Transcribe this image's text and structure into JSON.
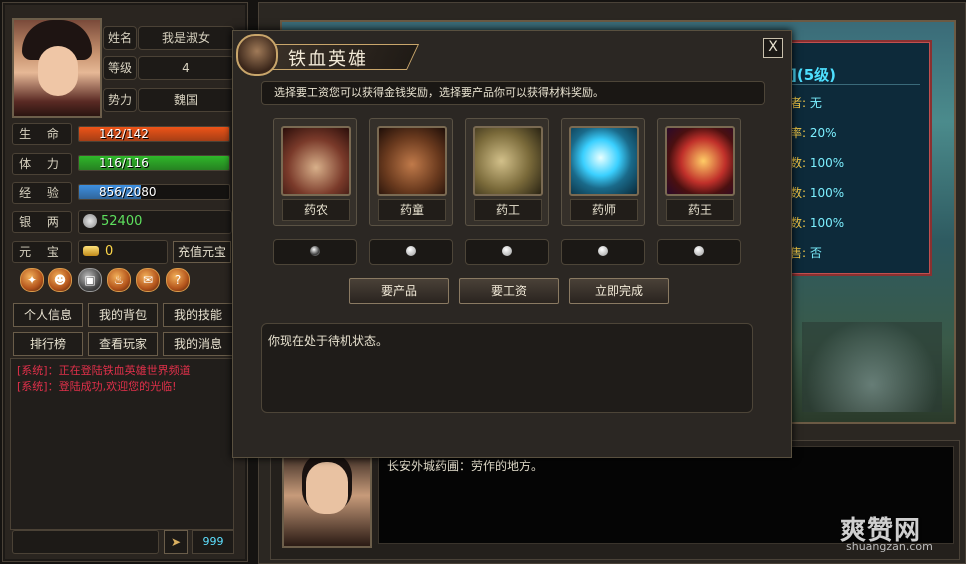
{
  "player": {
    "name_label": "姓名",
    "name": "我是淑女",
    "level_label": "等级",
    "level": "4",
    "faction_label": "势力",
    "faction": "魏国"
  },
  "stats": [
    {
      "label": "生 命",
      "text": "142/142",
      "fraction": 1.0,
      "color": "#ee5418"
    },
    {
      "label": "体 力",
      "text": "116/116",
      "fraction": 1.0,
      "color": "#2fb82a"
    },
    {
      "label": "经 验",
      "text": "856/2080",
      "fraction": 0.41,
      "color": "#3e8fe0"
    }
  ],
  "money": {
    "silver_label": "银 两",
    "silver": "52400",
    "gold_label": "元 宝",
    "gold": "0",
    "recharge": "充值元宝"
  },
  "menu": {
    "row1": [
      "个人信息",
      "我的背包",
      "我的技能"
    ],
    "row2": [
      "排行榜",
      "查看玩家",
      "我的消息"
    ]
  },
  "chat": [
    "[系统]：正在登陆铁血英雄世界频道",
    "[系统]：登陆成功,欢迎您的光临!"
  ],
  "chat_bottom": {
    "count": "999"
  },
  "info": {
    "title": "](5级)",
    "rows": [
      {
        "k": "者:",
        "v": "无"
      },
      {
        "k": "率:",
        "v": "20%"
      },
      {
        "k": "数:",
        "v": "100%"
      },
      {
        "k": "数:",
        "v": "100%"
      },
      {
        "k": "数:",
        "v": "100%"
      },
      {
        "k": "售:",
        "v": "否"
      }
    ]
  },
  "npc": {
    "text": "长安外城药圃：劳作的地方。"
  },
  "watermark": {
    "main": "爽赞网",
    "sub": "shuangzan.com"
  },
  "dialog": {
    "title": "铁血英雄",
    "close": "X",
    "hint": "选择要工资您可以获得金钱奖励，选择要产品你可以获得材料奖励。",
    "options": [
      {
        "name": "药农",
        "icon": "mortar-icon",
        "selected": true
      },
      {
        "name": "药童",
        "icon": "herb-powder-icon",
        "selected": false
      },
      {
        "name": "药工",
        "icon": "herb-grinder-icon",
        "selected": false
      },
      {
        "name": "药师",
        "icon": "medicine-bottle-icon",
        "selected": false
      },
      {
        "name": "药王",
        "icon": "medicine-pot-icon",
        "selected": false
      }
    ],
    "buttons": {
      "product": "要产品",
      "wage": "要工资",
      "finish": "立即完成"
    },
    "status": "你现在处于待机状态。"
  }
}
